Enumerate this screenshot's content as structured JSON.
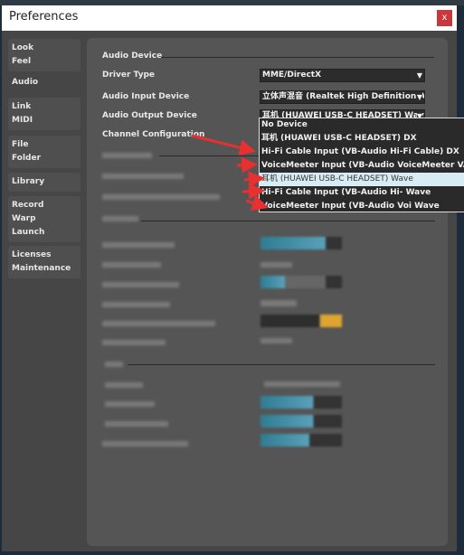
{
  "window": {
    "title": "Preferences",
    "close_label": "x"
  },
  "sidebar": {
    "tabs": [
      {
        "lines": [
          "Look",
          "Feel"
        ]
      },
      {
        "lines": [
          "Audio"
        ],
        "selected": true
      },
      {
        "lines": [
          "Link",
          "MIDI"
        ]
      },
      {
        "lines": [
          "File",
          "Folder"
        ]
      },
      {
        "lines": [
          "Library"
        ]
      },
      {
        "lines": [
          "Record",
          "Warp",
          "Launch"
        ]
      },
      {
        "lines": [
          "Licenses",
          "Maintenance"
        ]
      }
    ]
  },
  "audio": {
    "section_title": "Audio Device",
    "driver_type": {
      "label": "Driver Type",
      "value": "MME/DirectX"
    },
    "input_device": {
      "label": "Audio Input Device",
      "value": "立体声混音 (Realtek High Definition Au"
    },
    "output_device": {
      "label": "Audio Output Device",
      "value": "耳机 (HUAWEI USB-C HEADSET) Wave"
    },
    "channel_config": {
      "label": "Channel Configuration"
    },
    "output_options": [
      "No Device",
      "耳机 (HUAWEI USB-C HEADSET) DX",
      "Hi-Fi Cable Input (VB-Audio Hi-Fi Cable) DX",
      "VoiceMeeter Input (VB-Audio VoiceMeeter VAIO) DX",
      "耳机 (HUAWEI USB-C HEADSET) Wave",
      "Hi-Fi Cable Input (VB-Audio Hi- Wave",
      "VoiceMeeter Input (VB-Audio Voi Wave"
    ],
    "highlighted_option": "耳机 (HUAWEI USB-C HEADSET) Wave"
  },
  "colors": {
    "accent": "#3a8fa8",
    "annotation_arrow": "#e83030",
    "close": "#c8383c",
    "highlight": "#d8ecf5",
    "toggle": "#e0a530"
  },
  "annotations": {
    "arrow_icon": "red-arrow",
    "count": 5
  }
}
